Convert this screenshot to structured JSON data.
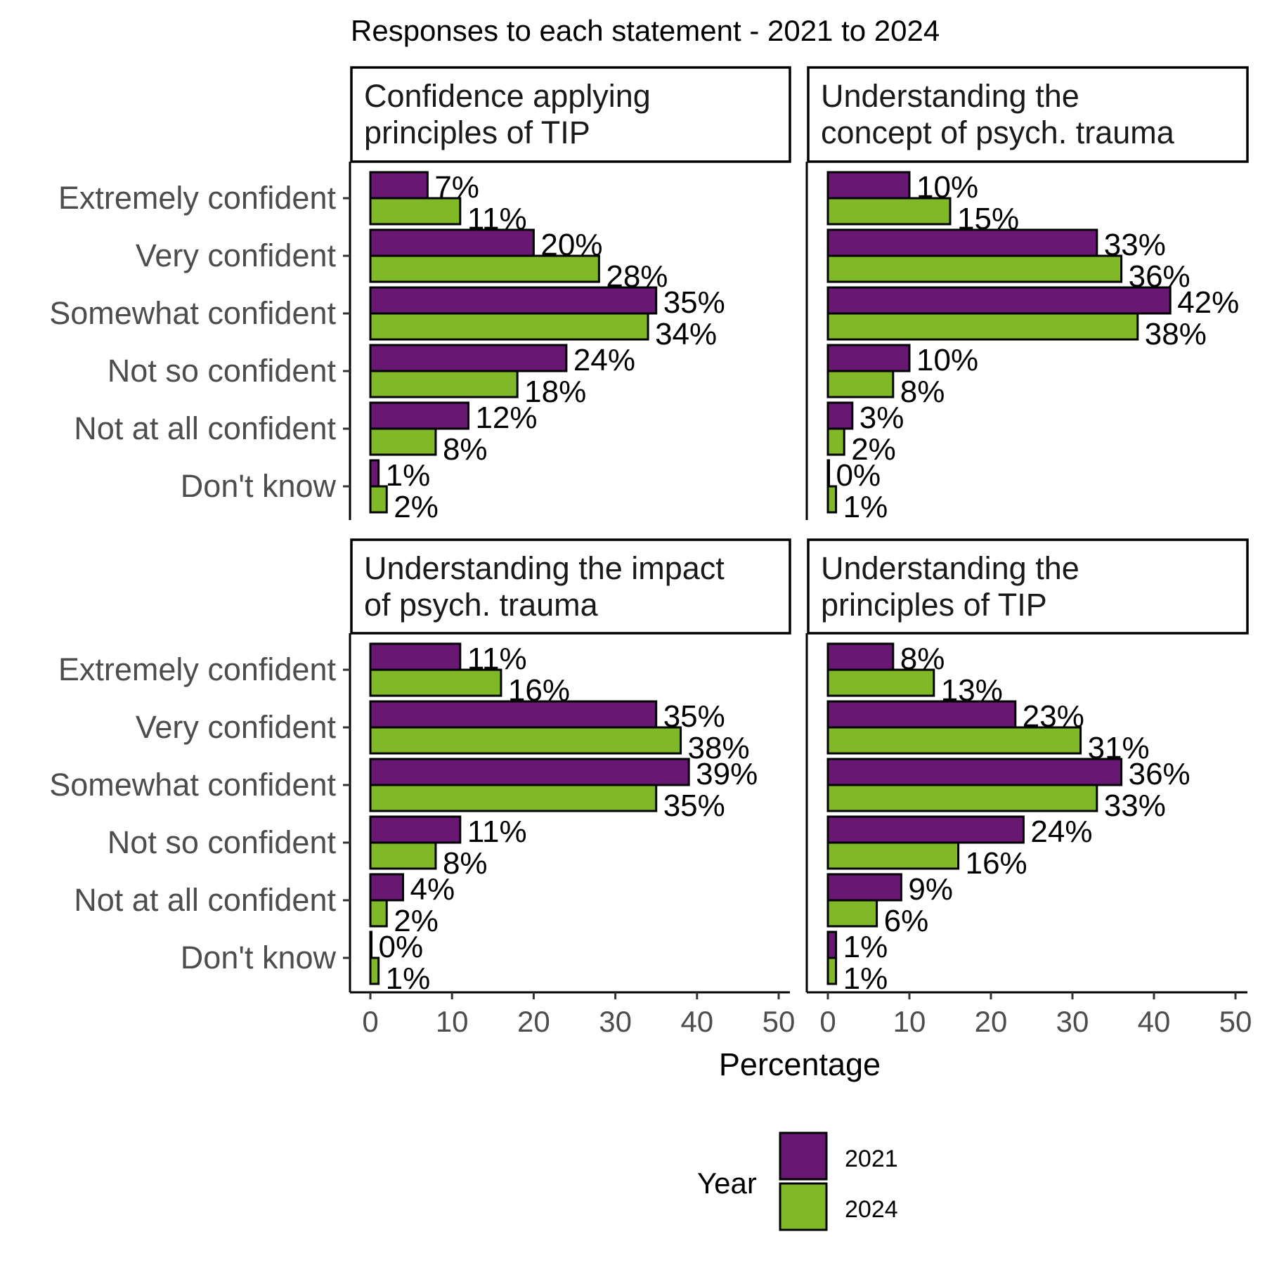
{
  "chart_data": {
    "type": "bar",
    "orientation": "horizontal",
    "title": "Responses to each statement - 2021 to 2024",
    "xlabel": "Percentage",
    "ylabel": "",
    "xlim": [
      0,
      50
    ],
    "xticks": [
      "0",
      "10",
      "20",
      "30",
      "40",
      "50"
    ],
    "categories": [
      "Extremely confident",
      "Very confident",
      "Somewhat confident",
      "Not so confident",
      "Not at all confident",
      "Don't know"
    ],
    "legend": {
      "title": "Year",
      "position": "bottom",
      "entries": [
        {
          "name": "2021",
          "color": "#681873"
        },
        {
          "name": "2024",
          "color": "#80b828"
        }
      ]
    },
    "panels": [
      {
        "title": "Confidence applying\nprinciples of TIP",
        "series": [
          {
            "name": "2021",
            "values": [
              7,
              20,
              35,
              24,
              12,
              1
            ],
            "labels": [
              "7%",
              "20%",
              "35%",
              "24%",
              "12%",
              "1%"
            ]
          },
          {
            "name": "2024",
            "values": [
              11,
              28,
              34,
              18,
              8,
              2
            ],
            "labels": [
              "11%",
              "28%",
              "34%",
              "18%",
              "8%",
              "2%"
            ]
          }
        ]
      },
      {
        "title": "Understanding the\nconcept of psych. trauma",
        "series": [
          {
            "name": "2021",
            "values": [
              10,
              33,
              42,
              10,
              3,
              0
            ],
            "labels": [
              "10%",
              "33%",
              "42%",
              "10%",
              "3%",
              "0%"
            ]
          },
          {
            "name": "2024",
            "values": [
              15,
              36,
              38,
              8,
              2,
              1
            ],
            "labels": [
              "15%",
              "36%",
              "38%",
              "8%",
              "2%",
              "1%"
            ]
          }
        ]
      },
      {
        "title": "Understanding the impact\nof psych. trauma",
        "series": [
          {
            "name": "2021",
            "values": [
              11,
              35,
              39,
              11,
              4,
              0
            ],
            "labels": [
              "11%",
              "35%",
              "39%",
              "11%",
              "4%",
              "0%"
            ]
          },
          {
            "name": "2024",
            "values": [
              16,
              38,
              35,
              8,
              2,
              1
            ],
            "labels": [
              "16%",
              "38%",
              "35%",
              "8%",
              "2%",
              "1%"
            ]
          }
        ]
      },
      {
        "title": "Understanding the\nprinciples of TIP",
        "series": [
          {
            "name": "2021",
            "values": [
              8,
              23,
              36,
              24,
              9,
              1
            ],
            "labels": [
              "8%",
              "23%",
              "36%",
              "24%",
              "9%",
              "1%"
            ]
          },
          {
            "name": "2024",
            "values": [
              13,
              31,
              33,
              16,
              6,
              1
            ],
            "labels": [
              "13%",
              "31%",
              "33%",
              "16%",
              "6%",
              "1%"
            ]
          }
        ]
      }
    ]
  }
}
